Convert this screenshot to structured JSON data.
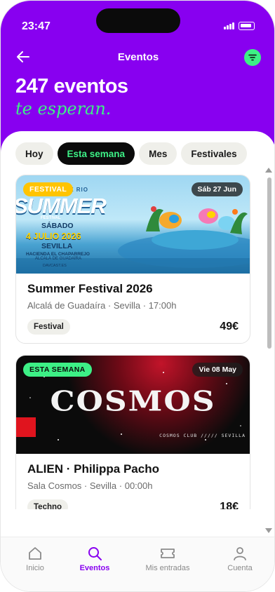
{
  "status_bar": {
    "time": "23:47"
  },
  "header": {
    "title": "Eventos"
  },
  "hero": {
    "headline": "247 eventos",
    "subheadline": "te esperan."
  },
  "filters": [
    {
      "label": "Hoy",
      "active": false
    },
    {
      "label": "Esta semana",
      "active": true
    },
    {
      "label": "Mes",
      "active": false
    },
    {
      "label": "Festivales",
      "active": false
    }
  ],
  "events": [
    {
      "badge": "FESTIVAL",
      "date": "Sáb 27 Jun",
      "title": "Summer Festival 2026",
      "venue": "Alcalá de Guadaíra · Sevilla · 17:00h",
      "tag": "Festival",
      "price": "49€",
      "poster": {
        "top": "X  DAVEX   RIO",
        "word": "SUMMER",
        "sub": "FESTIVAL",
        "line1": "SÁBADO",
        "line2": "4 JULIO 2026",
        "line3": "SEVILLA",
        "line4": "HACIENDA EL CHAPARREJO",
        "line5": "ALCALÁ DE GUADAÍRA",
        "line6": "DAVCAST.ES"
      }
    },
    {
      "badge": "ESTA SEMANA",
      "date": "Vie 08 May",
      "title": "ALIEN · Philippa Pacho",
      "venue": "Sala Cosmos · Sevilla · 00:00h",
      "tag": "Techno",
      "price": "18€",
      "poster": {
        "word": "COSMOS",
        "tagline": "COSMOS CLUB ///// SEVILLA"
      }
    }
  ],
  "tabbar": [
    {
      "label": "Inicio",
      "icon": "home-icon",
      "active": false
    },
    {
      "label": "Eventos",
      "icon": "search-icon",
      "active": true
    },
    {
      "label": "Mis entradas",
      "icon": "ticket-icon",
      "active": false
    },
    {
      "label": "Cuenta",
      "icon": "user-icon",
      "active": false
    }
  ],
  "colors": {
    "brand": "#8800f0",
    "accent": "#3df086",
    "badge_festival": "#ffc400"
  }
}
